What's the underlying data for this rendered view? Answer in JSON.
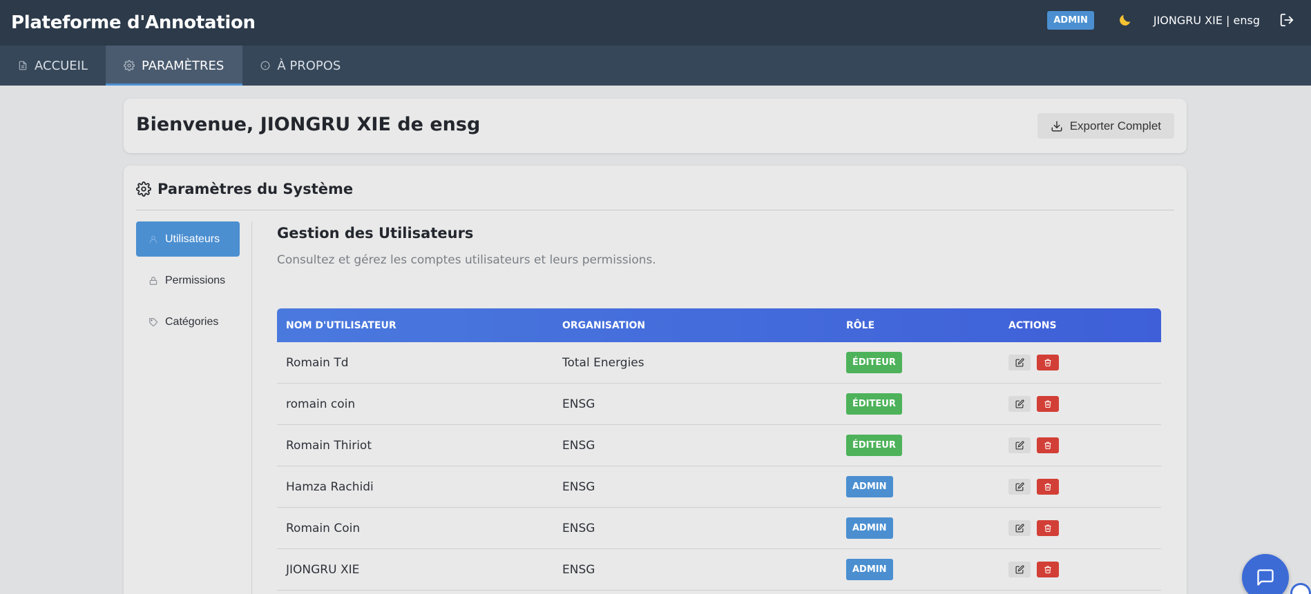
{
  "app": {
    "title": "Plateforme d'Annotation"
  },
  "topbar": {
    "role_badge": "ADMIN",
    "user_info": "JIONGRU XIE | ensg",
    "theme_icon": "moon-icon",
    "logout_icon": "logout-icon"
  },
  "nav": {
    "tabs": [
      {
        "label": "ACCUEIL",
        "icon": "document-icon",
        "active": false
      },
      {
        "label": "PARAMÈTRES",
        "icon": "gear-icon",
        "active": true
      },
      {
        "label": "À PROPOS",
        "icon": "info-icon",
        "active": false
      }
    ]
  },
  "welcome": {
    "title": "Bienvenue, JIONGRU XIE de ensg",
    "export_label": "Exporter Complet"
  },
  "settings": {
    "title": "Paramètres du Système",
    "menu": [
      {
        "label": "Utilisateurs",
        "icon": "user-icon",
        "active": true
      },
      {
        "label": "Permissions",
        "icon": "lock-icon",
        "active": false
      },
      {
        "label": "Catégories",
        "icon": "tag-icon",
        "active": false
      }
    ]
  },
  "users": {
    "title": "Gestion des Utilisateurs",
    "subtitle": "Consultez et gérez les comptes utilisateurs et leurs permissions.",
    "columns": [
      "NOM D'UTILISATEUR",
      "ORGANISATION",
      "RÔLE",
      "ACTIONS"
    ],
    "rows": [
      {
        "name": "Romain Td",
        "org": "Total Energies",
        "role": "ÉDITEUR"
      },
      {
        "name": "romain coin",
        "org": "ENSG",
        "role": "ÉDITEUR"
      },
      {
        "name": "Romain Thiriot",
        "org": "ENSG",
        "role": "ÉDITEUR"
      },
      {
        "name": "Hamza Rachidi",
        "org": "ENSG",
        "role": "ADMIN"
      },
      {
        "name": "Romain Coin",
        "org": "ENSG",
        "role": "ADMIN"
      },
      {
        "name": "JIONGRU XIE",
        "org": "ENSG",
        "role": "ADMIN"
      }
    ]
  },
  "colors": {
    "topbar": "#2c3a4a",
    "navbar": "#364759",
    "accent": "#4b8fd1",
    "editor": "#4db25a",
    "delete": "#d23f36",
    "table_header": "#4a79de"
  }
}
